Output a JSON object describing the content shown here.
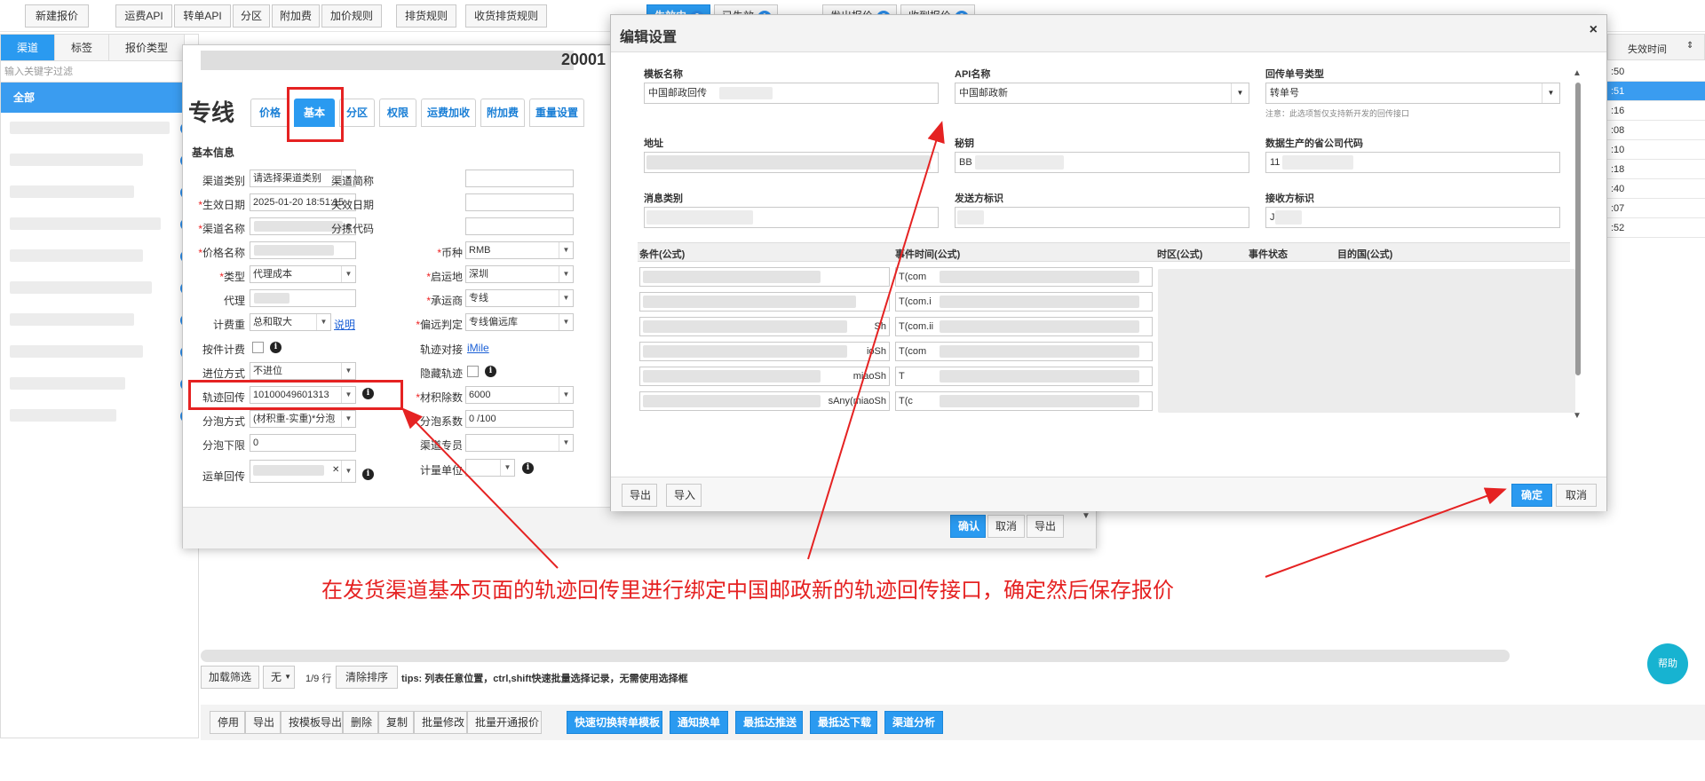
{
  "toolbar": {
    "new_quote": "新建报价",
    "freight_api": "运费API",
    "transfer_api": "转单API",
    "zone": "分区",
    "surcharge": "附加费",
    "markup_rule": "加价规则",
    "sort_rule": "排货规则",
    "receive_sort_rule": "收货排货规则",
    "tab_active": "生效中",
    "tab_active_count": "0",
    "tab_expired": "已失效",
    "tab_expired_count": "1",
    "tab_issued": "发出报价",
    "tab_issued_count": "0",
    "tab_received": "收到报价",
    "tab_received_count": "0"
  },
  "sidebar": {
    "tabs": [
      "渠道",
      "标签",
      "报价类型"
    ],
    "filter_placeholder": "输入关键字过滤",
    "all_label": "全部",
    "counts": [
      "1",
      "1",
      "1",
      "1",
      "1",
      "1",
      "1",
      "1",
      "1",
      "1"
    ]
  },
  "right_table": {
    "header": "失效时间",
    "rows": [
      ":50",
      ":51",
      ":16",
      ":08",
      ":10",
      ":18",
      ":40",
      ":07",
      ":52"
    ]
  },
  "form": {
    "title_suffix": "20001",
    "logo_text": "专线",
    "tabs": [
      "价格",
      "基本",
      "分区",
      "权限",
      "运费加收",
      "附加费",
      "重量设置"
    ],
    "section": "基本信息",
    "left": {
      "channel_type_label": "渠道类别",
      "channel_type_value": "请选择渠道类别",
      "effective_label": "生效日期",
      "effective_value": "2025-01-20 18:51:15",
      "channel_name_label": "渠道名称",
      "channel_name_value": "e",
      "price_name_label": "价格名称",
      "type_label": "类型",
      "type_value": "代理成本",
      "agent_label": "代理",
      "weight_label": "计费重",
      "weight_value": "总和取大",
      "weight_link": "说明",
      "piece_label": "按件计费",
      "carry_label": "进位方式",
      "carry_value": "不进位",
      "track_label": "轨迹回传",
      "track_value": "10100049601313",
      "split_label": "分泡方式",
      "split_value": "(材积重-实重)*分泡",
      "split_min_label": "分泡下限",
      "split_min_value": "0",
      "waybill_label": "运单回传"
    },
    "right": {
      "short_label": "渠道简称",
      "expire_label": "失效日期",
      "sort_code_label": "分拣代码",
      "currency_label": "币种",
      "currency_value": "RMB",
      "origin_label": "启运地",
      "origin_value": "深圳",
      "carrier_label": "承运商",
      "carrier_value": "专线",
      "remote_label": "偏远判定",
      "remote_value": "专线偏远库",
      "track_dock_label": "轨迹对接",
      "track_dock_link": "iMile",
      "hide_track_label": "隐藏轨迹",
      "volume_label": "材积除数",
      "volume_value": "6000",
      "split_coef_label": "分泡系数",
      "split_coef_value": "0 /100",
      "staff_label": "渠道专员",
      "unit_label": "计量单位"
    },
    "footer": {
      "confirm": "确认",
      "cancel": "取消",
      "export": "导出"
    }
  },
  "edit": {
    "title": "编辑设置",
    "close": "×",
    "template_label": "模板名称",
    "template_value": "中国邮政回传",
    "api_label": "API名称",
    "api_value": "中国邮政新",
    "return_type_label": "回传单号类型",
    "return_type_value": "转单号",
    "return_note": "注意：此选项暂仅支持新开发的回传接口",
    "address_label": "地址",
    "secret_label": "秘钥",
    "secret_value": "BB",
    "province_label": "数据生产的省公司代码",
    "province_value": "11",
    "msg_label": "消息类别",
    "sender_label": "发送方标识",
    "receiver_label": "接收方标识",
    "receiver_value": "J",
    "grid_headers": [
      "条件(公式)",
      "事件时间(公式)",
      "时区(公式)",
      "事件状态",
      "目的国(公式)"
    ],
    "grid_col1_tails": [
      "",
      "",
      "Sh",
      "ioSh",
      "miaoSh",
      "sAny(miaoSh"
    ],
    "grid_col2": [
      "T(com",
      "T(com.i",
      "T(com.ii",
      "T(com",
      "T",
      "T(c"
    ],
    "export": "导出",
    "import": "导入",
    "ok": "确定",
    "cancel": "取消"
  },
  "bottom": {
    "load_filter": "加载筛选",
    "filter_none": "无",
    "pager": "1/9 行",
    "clear_sort": "清除排序",
    "tips": "tips: 列表任意位置，ctrl,shift快速批量选择记录，无需使用选择框",
    "actions": [
      "停用",
      "导出",
      "按模板导出",
      "删除",
      "复制",
      "批量修改",
      "批量开通报价"
    ],
    "blue_actions": [
      "快速切换转单模板",
      "通知换单",
      "最抵达推送",
      "最抵达下载",
      "渠道分析"
    ]
  },
  "annotation": "在发货渠道基本页面的轨迹回传里进行绑定中国邮政新的轨迹回传接口，确定然后保存报价",
  "help": "帮助"
}
